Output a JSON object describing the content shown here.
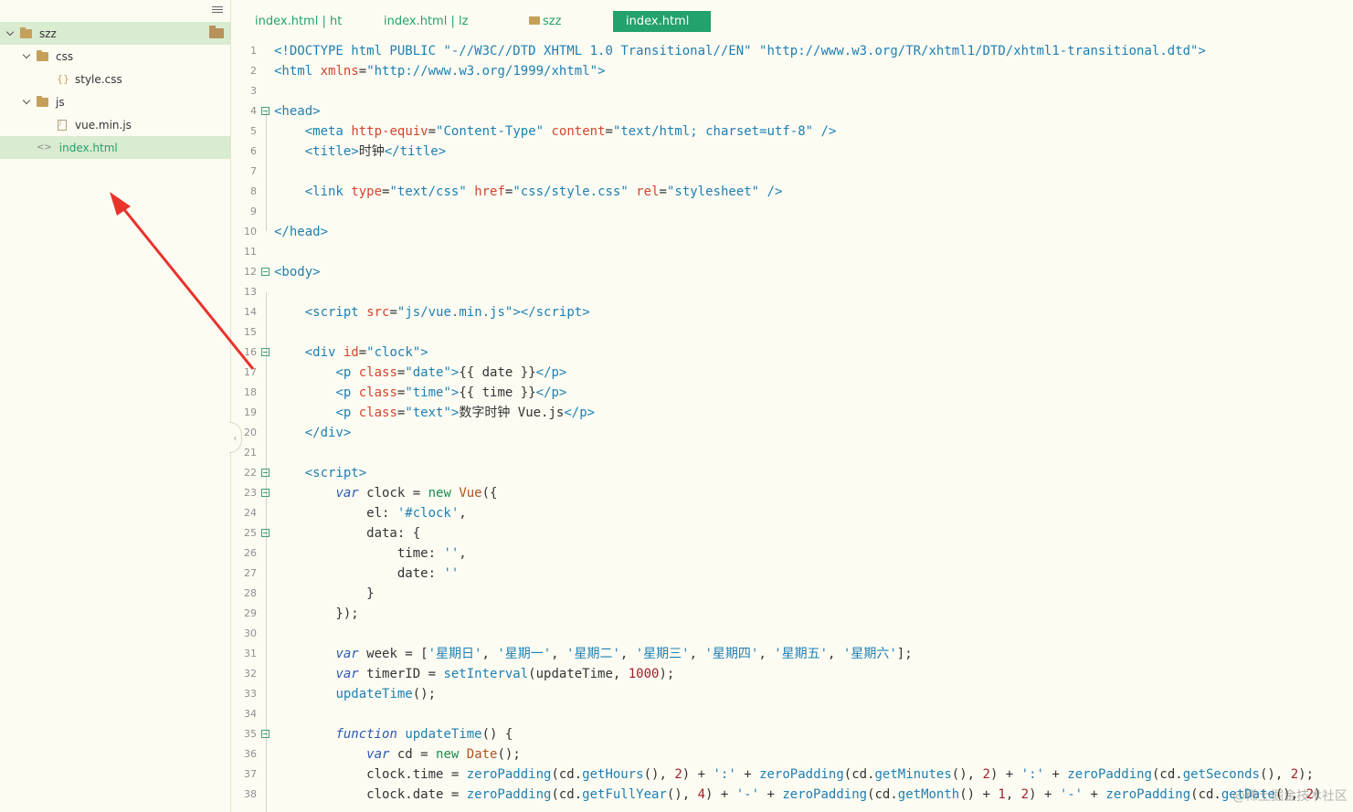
{
  "sidebar": {
    "tree": [
      {
        "label": "szz",
        "type": "folder",
        "expanded": true,
        "selected": true
      },
      {
        "label": "css",
        "type": "folder",
        "expanded": true
      },
      {
        "label": "style.css",
        "type": "css"
      },
      {
        "label": "js",
        "type": "folder",
        "expanded": true
      },
      {
        "label": "vue.min.js",
        "type": "js"
      },
      {
        "label": "index.html",
        "type": "html",
        "active": true
      }
    ]
  },
  "tabs": [
    {
      "label": "index.html | ht"
    },
    {
      "label": "index.html | lz"
    },
    {
      "label": "szz",
      "icon": "folder-icon"
    },
    {
      "label": "index.html",
      "active": true
    }
  ],
  "editor": {
    "lines": [
      {
        "n": "1",
        "fold": false,
        "html": "<span class='t'>&lt;!DOCTYPE html PUBLIC</span> <span class='s'>\"-//W3C//DTD XHTML 1.0 Transitional//EN\"</span> <span class='s'>\"http://www.w3.org/TR/xhtml1/DTD/xhtml1-transitional.dtd\"</span><span class='t'>&gt;</span>"
      },
      {
        "n": "2",
        "fold": false,
        "html": "<span class='t'>&lt;html</span> <span class='a'>xmlns</span>=<span class='s'>\"http://www.w3.org/1999/xhtml\"</span><span class='t'>&gt;</span>"
      },
      {
        "n": "3",
        "fold": false,
        "html": ""
      },
      {
        "n": "4",
        "fold": true,
        "html": "<span class='t'>&lt;head&gt;</span>"
      },
      {
        "n": "5",
        "fold": false,
        "html": "    <span class='t'>&lt;meta</span> <span class='a'>http-equiv</span>=<span class='s'>\"Content-Type\"</span> <span class='a'>content</span>=<span class='s'>\"text/html; charset=utf-8\"</span> <span class='t'>/&gt;</span>"
      },
      {
        "n": "6",
        "fold": false,
        "html": "    <span class='t'>&lt;title&gt;</span>时钟<span class='t'>&lt;/title&gt;</span>"
      },
      {
        "n": "7",
        "fold": false,
        "html": ""
      },
      {
        "n": "8",
        "fold": false,
        "html": "    <span class='t'>&lt;link</span> <span class='a'>type</span>=<span class='s'>\"text/css\"</span> <span class='a'>href</span>=<span class='s'>\"css/style.css\"</span> <span class='a'>rel</span>=<span class='s'>\"stylesheet\"</span> <span class='t'>/&gt;</span>"
      },
      {
        "n": "9",
        "fold": false,
        "html": ""
      },
      {
        "n": "10",
        "fold": false,
        "html": "<span class='t'>&lt;/head&gt;</span>"
      },
      {
        "n": "11",
        "fold": false,
        "html": ""
      },
      {
        "n": "12",
        "fold": true,
        "html": "<span class='t'>&lt;body&gt;</span>"
      },
      {
        "n": "13",
        "fold": false,
        "html": ""
      },
      {
        "n": "14",
        "fold": false,
        "html": "    <span class='t'>&lt;script</span> <span class='a'>src</span>=<span class='s'>\"js/vue.min.js\"</span><span class='t'>&gt;&lt;/script&gt;</span>"
      },
      {
        "n": "15",
        "fold": false,
        "html": ""
      },
      {
        "n": "16",
        "fold": true,
        "html": "    <span class='t'>&lt;div</span> <span class='a'>id</span>=<span class='s'>\"clock\"</span><span class='t'>&gt;</span>"
      },
      {
        "n": "17",
        "fold": false,
        "html": "        <span class='t'>&lt;p</span> <span class='a'>class</span>=<span class='s'>\"date\"</span><span class='t'>&gt;</span>{{ date }}<span class='t'>&lt;/p&gt;</span>"
      },
      {
        "n": "18",
        "fold": false,
        "html": "        <span class='t'>&lt;p</span> <span class='a'>class</span>=<span class='s'>\"time\"</span><span class='t'>&gt;</span>{{ time }}<span class='t'>&lt;/p&gt;</span>"
      },
      {
        "n": "19",
        "fold": false,
        "html": "        <span class='t'>&lt;p</span> <span class='a'>class</span>=<span class='s'>\"text\"</span><span class='t'>&gt;</span>数字时钟 Vue.js<span class='t'>&lt;/p&gt;</span>"
      },
      {
        "n": "20",
        "fold": false,
        "html": "    <span class='t'>&lt;/div&gt;</span>"
      },
      {
        "n": "21",
        "fold": false,
        "html": ""
      },
      {
        "n": "22",
        "fold": true,
        "html": "    <span class='t'>&lt;script&gt;</span>"
      },
      {
        "n": "23",
        "fold": true,
        "html": "        <span class='k'>var</span> clock = <span class='g'>new</span> <span class='f'>Vue</span>({"
      },
      {
        "n": "24",
        "fold": false,
        "html": "            el: <span class='s'>'#clock'</span>,"
      },
      {
        "n": "25",
        "fold": true,
        "html": "            data: {"
      },
      {
        "n": "26",
        "fold": false,
        "html": "                time: <span class='s'>''</span>,"
      },
      {
        "n": "27",
        "fold": false,
        "html": "                date: <span class='s'>''</span>"
      },
      {
        "n": "28",
        "fold": false,
        "html": "            }"
      },
      {
        "n": "29",
        "fold": false,
        "html": "        });"
      },
      {
        "n": "30",
        "fold": false,
        "html": ""
      },
      {
        "n": "31",
        "fold": false,
        "html": "        <span class='k'>var</span> week = [<span class='s'>'星期日'</span>, <span class='s'>'星期一'</span>, <span class='s'>'星期二'</span>, <span class='s'>'星期三'</span>, <span class='s'>'星期四'</span>, <span class='s'>'星期五'</span>, <span class='s'>'星期六'</span>];"
      },
      {
        "n": "32",
        "fold": false,
        "html": "        <span class='k'>var</span> timerID = <span class='t'>setInterval</span>(updateTime, <span class='n'>1000</span>);"
      },
      {
        "n": "33",
        "fold": false,
        "html": "        <span class='t'>updateTime</span>();"
      },
      {
        "n": "34",
        "fold": false,
        "html": ""
      },
      {
        "n": "35",
        "fold": true,
        "html": "        <span class='k'>function</span> <span class='t'>updateTime</span>() {"
      },
      {
        "n": "36",
        "fold": false,
        "html": "            <span class='k'>var</span> cd = <span class='g'>new</span> <span class='f'>Date</span>();"
      },
      {
        "n": "37",
        "fold": false,
        "html": "            clock.time = <span class='t'>zeroPadding</span>(cd.<span class='t'>getHours</span>(), <span class='n'>2</span>) + <span class='s'>':'</span> + <span class='t'>zeroPadding</span>(cd.<span class='t'>getMinutes</span>(), <span class='n'>2</span>) + <span class='s'>':'</span> + <span class='t'>zeroPadding</span>(cd.<span class='t'>getSeconds</span>(), <span class='n'>2</span>);"
      },
      {
        "n": "38",
        "fold": false,
        "html": "            clock.date = <span class='t'>zeroPadding</span>(cd.<span class='t'>getFullYear</span>(), <span class='n'>4</span>) + <span class='s'>'-'</span> + <span class='t'>zeroPadding</span>(cd.<span class='t'>getMonth</span>() + <span class='n'>1</span>, <span class='n'>2</span>) + <span class='s'>'-'</span> + <span class='t'>zeroPadding</span>(cd.<span class='t'>getDate</span>(), <span class='n'>2</span>)"
      }
    ]
  },
  "watermark": "@稀土掘金技术社区",
  "colors": {
    "accent": "#23a26b",
    "background": "#fdfcf3",
    "selection": "#d9ebd1",
    "arrow": "#e8332b"
  }
}
